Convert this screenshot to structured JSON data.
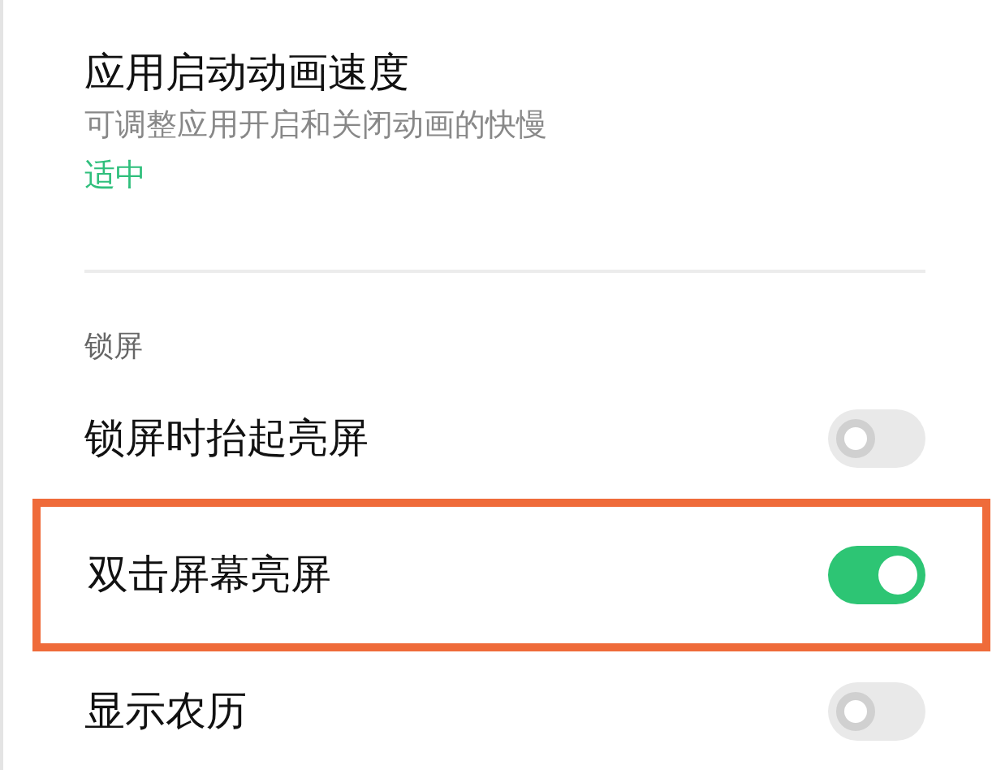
{
  "settings": [
    {
      "kind": "option",
      "title": "应用启动动画速度",
      "subtitle": "可调整应用开启和关闭动画的快慢",
      "value": "适中"
    },
    {
      "kind": "header",
      "title": "锁屏"
    },
    {
      "kind": "toggle",
      "title": "锁屏时抬起亮屏",
      "on": false,
      "highlighted": false
    },
    {
      "kind": "toggle",
      "title": "双击屏幕亮屏",
      "on": true,
      "highlighted": true
    },
    {
      "kind": "toggle",
      "title": "显示农历",
      "on": false,
      "highlighted": false
    }
  ]
}
